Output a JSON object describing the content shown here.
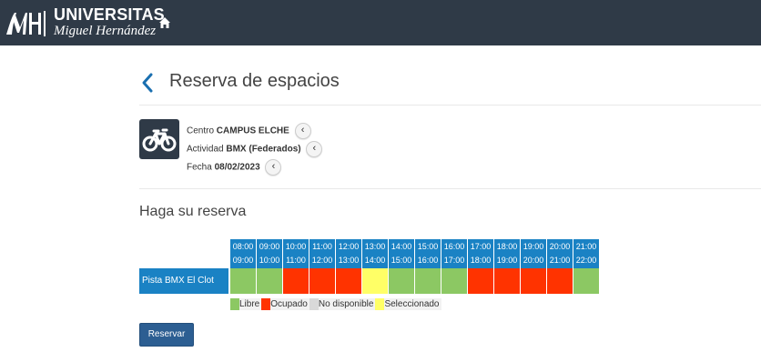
{
  "header": {
    "logo_line1": "UNIVERSITAS",
    "logo_line2": "Miguel Hernández",
    "home_icon": "home-icon"
  },
  "page": {
    "title": "Reserva de espacios"
  },
  "info": {
    "centro_label": "Centro",
    "centro_value": "CAMPUS ELCHE",
    "actividad_label": "Actividad",
    "actividad_value": "BMX (Federados)",
    "fecha_label": "Fecha",
    "fecha_value": "08/02/2023",
    "activity_icon": "bicycle-icon"
  },
  "booking": {
    "title": "Haga su reserva",
    "time_slots": [
      {
        "start": "08:00",
        "end": "09:00"
      },
      {
        "start": "09:00",
        "end": "10:00"
      },
      {
        "start": "10:00",
        "end": "11:00"
      },
      {
        "start": "11:00",
        "end": "12:00"
      },
      {
        "start": "12:00",
        "end": "13:00"
      },
      {
        "start": "13:00",
        "end": "14:00"
      },
      {
        "start": "14:00",
        "end": "15:00"
      },
      {
        "start": "15:00",
        "end": "16:00"
      },
      {
        "start": "16:00",
        "end": "17:00"
      },
      {
        "start": "17:00",
        "end": "18:00"
      },
      {
        "start": "18:00",
        "end": "19:00"
      },
      {
        "start": "19:00",
        "end": "20:00"
      },
      {
        "start": "20:00",
        "end": "21:00"
      },
      {
        "start": "21:00",
        "end": "22:00"
      }
    ],
    "rows": [
      {
        "label": "Pista BMX El Clot",
        "states": [
          "libre",
          "libre",
          "ocupado",
          "ocupado",
          "ocupado",
          "seleccionado",
          "libre",
          "libre",
          "libre",
          "ocupado",
          "ocupado",
          "ocupado",
          "ocupado",
          "libre"
        ]
      }
    ],
    "legend": [
      {
        "state": "libre",
        "label": "Libre",
        "color": "#8cc863"
      },
      {
        "state": "ocupado",
        "label": "Ocupado",
        "color": "#ff3300"
      },
      {
        "state": "no_disponible",
        "label": "No disponible",
        "color": "#d9d9d9"
      },
      {
        "state": "seleccionado",
        "label": "Seleccionado",
        "color": "#ffff66"
      }
    ],
    "reserve_label": "Reservar"
  },
  "colors": {
    "header_bg": "#2f3a47",
    "accent_blue": "#1a82c4",
    "button_blue": "#2c5e92"
  }
}
